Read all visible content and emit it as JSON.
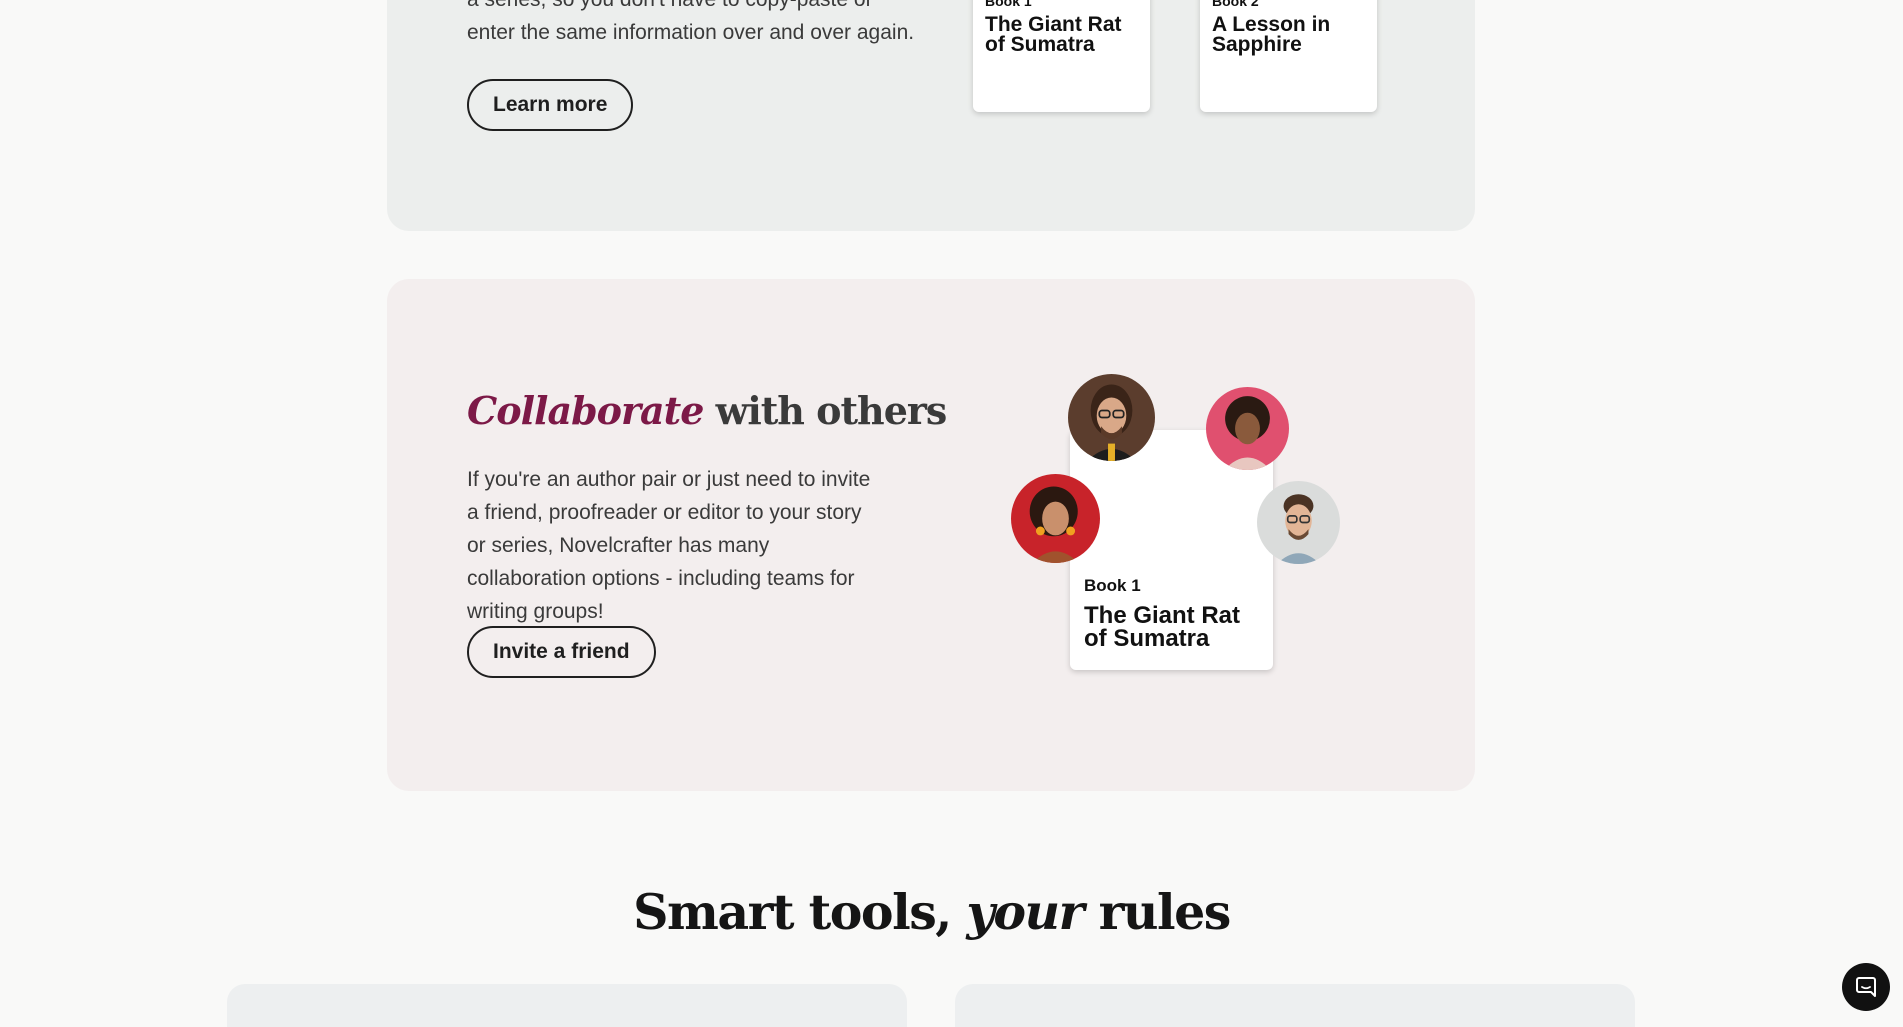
{
  "series_section": {
    "body_lines": [
      "a series, so you don't have to copy-paste or",
      "enter the same information over and over again."
    ],
    "button_label": "Learn more",
    "books": [
      {
        "kicker": "Book 1",
        "title": "The Giant Rat of Sumatra"
      },
      {
        "kicker": "Book 2",
        "title": "A Lesson in Sapphire"
      }
    ]
  },
  "collab_section": {
    "heading_accent": "Collaborate",
    "heading_rest": " with others",
    "body": "If you're an author pair or just need to invite a friend, proofreader or editor to your story or series, Novelcrafter has many collaboration options - including teams for writing groups!",
    "button_label": "Invite a friend",
    "book": {
      "kicker": "Book 1",
      "title": "The Giant Rat of Sumatra"
    }
  },
  "tools_section": {
    "title_before": "Smart tools, ",
    "title_em": "your",
    "title_after": " rules"
  },
  "colors": {
    "accent": "#7c1947",
    "page_bg": "#f9f9f8",
    "series_panel_bg": "#eceeed",
    "collab_panel_bg": "#f3eeee"
  },
  "icons": {
    "chat_button": "chat-bubble-icon"
  }
}
